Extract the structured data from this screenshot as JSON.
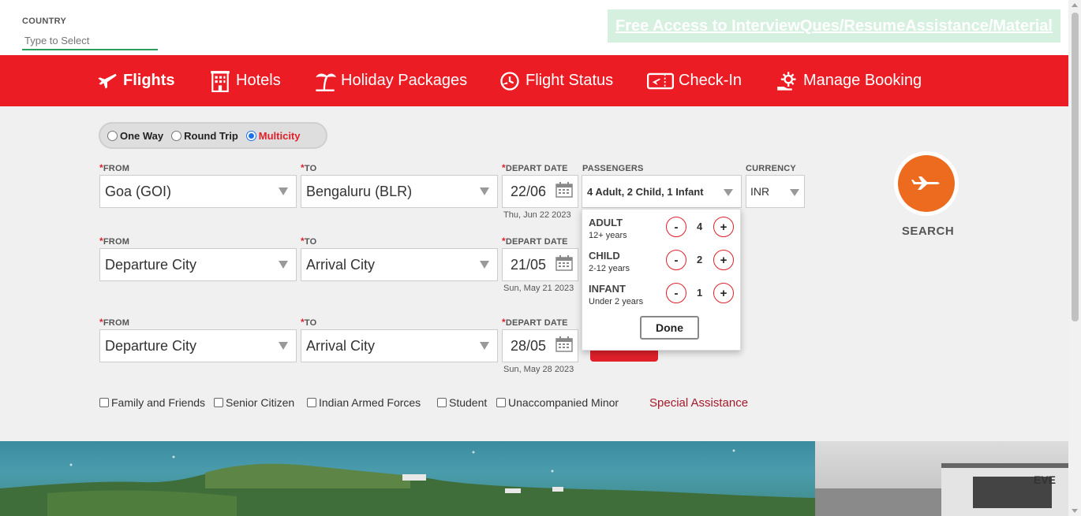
{
  "country": {
    "label": "COUNTRY",
    "placeholder": "Type to Select"
  },
  "promo": {
    "text": "Free Access to InterviewQues/ResumeAssistance/Material"
  },
  "nav": {
    "items": [
      {
        "label": "Flights",
        "icon": "plane-icon"
      },
      {
        "label": "Hotels",
        "icon": "hotel-icon"
      },
      {
        "label": "Holiday Packages",
        "icon": "palm-tree-icon"
      },
      {
        "label": "Flight Status",
        "icon": "flight-status-icon"
      },
      {
        "label": "Check-In",
        "icon": "ticket-icon"
      },
      {
        "label": "Manage Booking",
        "icon": "gear-hand-icon"
      }
    ]
  },
  "trip_type": {
    "options": [
      "One Way",
      "Round Trip",
      "Multicity"
    ],
    "selected": "Multicity"
  },
  "labels": {
    "req": "*",
    "from": "FROM",
    "to": "TO",
    "depart": "DEPART DATE",
    "passengers": "PASSENGERS",
    "currency": "CURRENCY"
  },
  "legs": [
    {
      "from": "Goa (GOI)",
      "to": "Bengaluru (BLR)",
      "date": "22/06",
      "date_full": "Thu, Jun 22 2023"
    },
    {
      "from": "Departure City",
      "to": "Arrival City",
      "date": "21/05",
      "date_full": "Sun, May 21 2023"
    },
    {
      "from": "Departure City",
      "to": "Arrival City",
      "date": "28/05",
      "date_full": "Sun, May 28 2023"
    }
  ],
  "passengers": {
    "summary": "4 Adult, 2 Child, 1 Infant",
    "rows": [
      {
        "name": "ADULT",
        "desc": "12+ years",
        "count": "4"
      },
      {
        "name": "CHILD",
        "desc": "2-12 years",
        "count": "2"
      },
      {
        "name": "INFANT",
        "desc": "Under 2 years",
        "count": "1"
      }
    ],
    "minus": "-",
    "plus": "+",
    "done": "Done"
  },
  "currency": {
    "value": "INR"
  },
  "search": {
    "label": "SEARCH"
  },
  "concessions": [
    "Family and Friends",
    "Senior Citizen",
    "Indian Armed Forces",
    "Student",
    "Unaccompanied Minor"
  ],
  "special_assistance": "Special Assistance",
  "colors": {
    "brand_red": "#ec1c24",
    "search_orange": "#ed6b1f",
    "promo_bg": "#d6f0e0"
  }
}
